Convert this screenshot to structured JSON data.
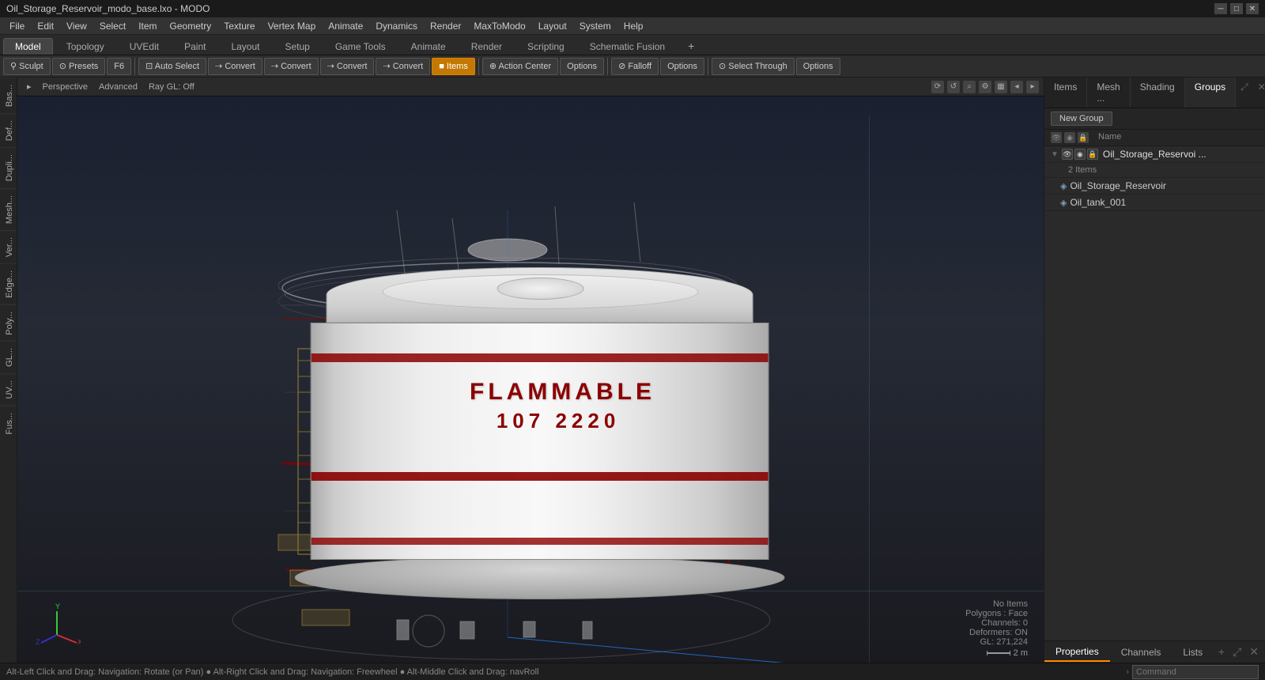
{
  "window": {
    "title": "Oil_Storage_Reservoir_modo_base.lxo - MODO"
  },
  "titlebar": {
    "title": "Oil_Storage_Reservoir_modo_base.lxo - MODO",
    "minimize": "─",
    "maximize": "□",
    "close": "✕"
  },
  "menubar": {
    "items": [
      "File",
      "Edit",
      "View",
      "Select",
      "Item",
      "Geometry",
      "Texture",
      "Vertex Map",
      "Animate",
      "Dynamics",
      "Render",
      "MaxToModo",
      "Layout",
      "System",
      "Help"
    ]
  },
  "mode_tabs": {
    "tabs": [
      "Model",
      "Topology",
      "UVEdit",
      "Paint",
      "Layout",
      "Setup",
      "Game Tools",
      "Animate",
      "Render",
      "Scripting",
      "Schematic Fusion"
    ],
    "active": "Model",
    "add_btn": "+"
  },
  "toolbar": {
    "sculpt": "Sculpt",
    "presets": "Presets",
    "f6": "F6",
    "auto_select": "Auto Select",
    "convert1": "Convert",
    "convert2": "Convert",
    "convert3": "Convert",
    "convert4": "Convert",
    "items": "Items",
    "action_center": "Action Center",
    "options1": "Options",
    "falloff": "Falloff",
    "options2": "Options",
    "select_through": "Select Through",
    "options3": "Options"
  },
  "viewport": {
    "mode": "Perspective",
    "render": "Advanced",
    "gl": "Ray GL: Off",
    "status": {
      "no_items": "No Items",
      "polygons": "Polygons : Face",
      "channels": "Channels: 0",
      "deformers": "Deformers: ON",
      "gl": "GL: 271,224",
      "scale": "2 m"
    }
  },
  "scene": {
    "tank_text1": "FLAMMABLE",
    "tank_text2": "107       2220"
  },
  "left_sidebar": {
    "tabs": [
      "Bas...",
      "Def...",
      "Dupli...",
      "Mesh...",
      "Ver...",
      "Edge...",
      "Poly...",
      "GL...",
      "UV...",
      "Fus..."
    ]
  },
  "right_panel": {
    "tabs": [
      "Items",
      "Mesh ...",
      "Shading",
      "Groups"
    ],
    "active_tab": "Groups",
    "new_group_btn": "New Group",
    "columns": {
      "name": "Name"
    },
    "tree": {
      "group": {
        "name": "Oil_Storage_Reservoi ...",
        "count": "2 Items",
        "children": [
          {
            "name": "Oil_Storage_Reservoir",
            "type": "mesh"
          },
          {
            "name": "Oil_tank_001",
            "type": "mesh"
          }
        ]
      }
    }
  },
  "bottom_panel": {
    "tabs": [
      "Properties",
      "Channels",
      "Lists"
    ],
    "active": "Properties",
    "add_btn": "+",
    "expand_btn": "⤢",
    "close_btn": "✕"
  },
  "status_bar": {
    "text": "Alt-Left Click and Drag: Navigation: Rotate (or Pan)  ●  Alt-Right Click and Drag: Navigation: Freewheel  ●  Alt-Middle Click and Drag: navRoll",
    "command_placeholder": "Command"
  }
}
